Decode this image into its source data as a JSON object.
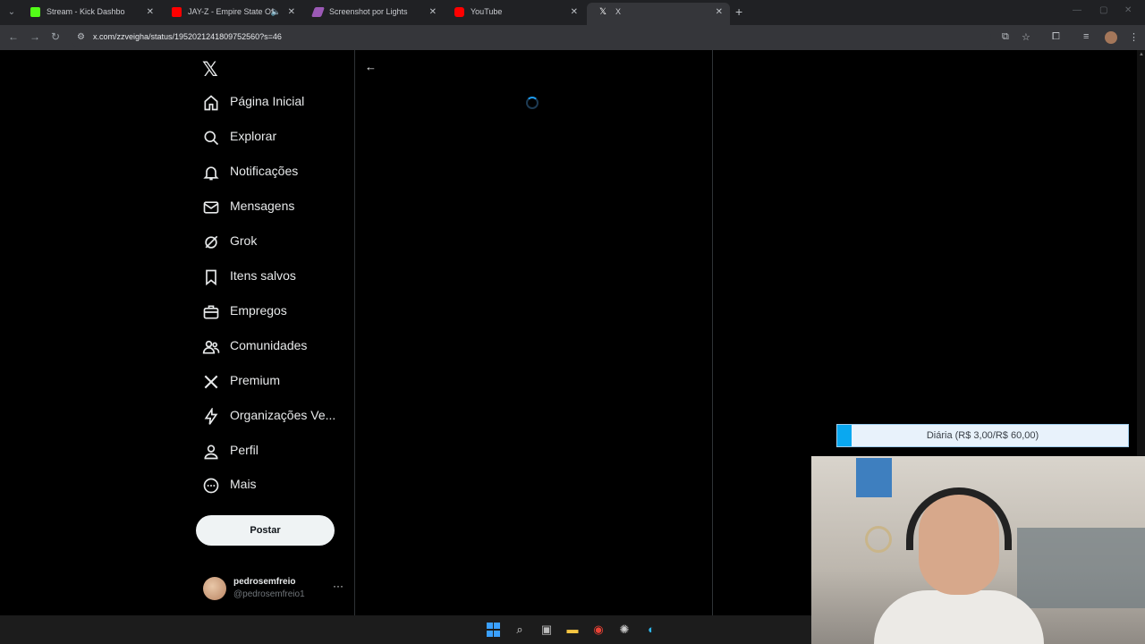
{
  "browser": {
    "tabs": [
      {
        "title": "Stream - Kick Dashboard",
        "favicon_color": "#53fc18",
        "active": false
      },
      {
        "title": "JAY-Z - Empire State Of Mi",
        "favicon_color": "#ff0000",
        "active": false
      },
      {
        "title": "Screenshot por Lightshot",
        "favicon_color": "#9b59b6",
        "active": false
      },
      {
        "title": "YouTube",
        "favicon_color": "#ff0000",
        "active": false
      },
      {
        "title": "X",
        "favicon_color": "#ffffff",
        "active": true
      }
    ],
    "url": "x.com/zzveigha/status/1952021241809752560?s=46"
  },
  "x": {
    "logo": "𝕏",
    "nav": [
      {
        "label": "Página Inicial",
        "icon": "home-icon"
      },
      {
        "label": "Explorar",
        "icon": "search-icon"
      },
      {
        "label": "Notificações",
        "icon": "bell-icon"
      },
      {
        "label": "Mensagens",
        "icon": "mail-icon"
      },
      {
        "label": "Grok",
        "icon": "grok-icon"
      },
      {
        "label": "Itens salvos",
        "icon": "bookmark-icon"
      },
      {
        "label": "Empregos",
        "icon": "briefcase-icon"
      },
      {
        "label": "Comunidades",
        "icon": "people-icon"
      },
      {
        "label": "Premium",
        "icon": "x-icon"
      },
      {
        "label": "Organizações Ve...",
        "icon": "bolt-icon"
      },
      {
        "label": "Perfil",
        "icon": "person-icon"
      },
      {
        "label": "Mais",
        "icon": "more-circle-icon"
      }
    ],
    "post_label": "Postar",
    "account": {
      "name": "pedrosemfreio",
      "handle": "@pedrosemfreio1"
    }
  },
  "overlay": {
    "goal_text": "Diária (R$ 3,00/R$ 60,00)",
    "goal_progress": 0.05
  },
  "colors": {
    "accent": "#1d9bf0",
    "goal_fill": "#0aa8f0"
  }
}
